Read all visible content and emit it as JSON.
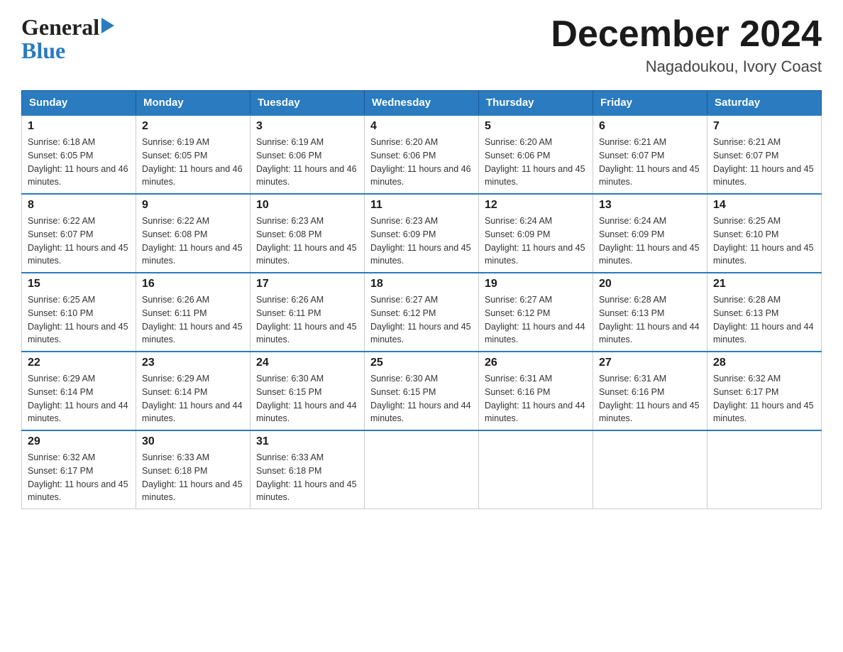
{
  "header": {
    "month_title": "December 2024",
    "location": "Nagadoukou, Ivory Coast"
  },
  "logo": {
    "line1": "General",
    "line2": "Blue"
  },
  "columns": [
    "Sunday",
    "Monday",
    "Tuesday",
    "Wednesday",
    "Thursday",
    "Friday",
    "Saturday"
  ],
  "weeks": [
    [
      {
        "day": "1",
        "sunrise": "6:18 AM",
        "sunset": "6:05 PM",
        "daylight": "11 hours and 46 minutes."
      },
      {
        "day": "2",
        "sunrise": "6:19 AM",
        "sunset": "6:05 PM",
        "daylight": "11 hours and 46 minutes."
      },
      {
        "day": "3",
        "sunrise": "6:19 AM",
        "sunset": "6:06 PM",
        "daylight": "11 hours and 46 minutes."
      },
      {
        "day": "4",
        "sunrise": "6:20 AM",
        "sunset": "6:06 PM",
        "daylight": "11 hours and 46 minutes."
      },
      {
        "day": "5",
        "sunrise": "6:20 AM",
        "sunset": "6:06 PM",
        "daylight": "11 hours and 45 minutes."
      },
      {
        "day": "6",
        "sunrise": "6:21 AM",
        "sunset": "6:07 PM",
        "daylight": "11 hours and 45 minutes."
      },
      {
        "day": "7",
        "sunrise": "6:21 AM",
        "sunset": "6:07 PM",
        "daylight": "11 hours and 45 minutes."
      }
    ],
    [
      {
        "day": "8",
        "sunrise": "6:22 AM",
        "sunset": "6:07 PM",
        "daylight": "11 hours and 45 minutes."
      },
      {
        "day": "9",
        "sunrise": "6:22 AM",
        "sunset": "6:08 PM",
        "daylight": "11 hours and 45 minutes."
      },
      {
        "day": "10",
        "sunrise": "6:23 AM",
        "sunset": "6:08 PM",
        "daylight": "11 hours and 45 minutes."
      },
      {
        "day": "11",
        "sunrise": "6:23 AM",
        "sunset": "6:09 PM",
        "daylight": "11 hours and 45 minutes."
      },
      {
        "day": "12",
        "sunrise": "6:24 AM",
        "sunset": "6:09 PM",
        "daylight": "11 hours and 45 minutes."
      },
      {
        "day": "13",
        "sunrise": "6:24 AM",
        "sunset": "6:09 PM",
        "daylight": "11 hours and 45 minutes."
      },
      {
        "day": "14",
        "sunrise": "6:25 AM",
        "sunset": "6:10 PM",
        "daylight": "11 hours and 45 minutes."
      }
    ],
    [
      {
        "day": "15",
        "sunrise": "6:25 AM",
        "sunset": "6:10 PM",
        "daylight": "11 hours and 45 minutes."
      },
      {
        "day": "16",
        "sunrise": "6:26 AM",
        "sunset": "6:11 PM",
        "daylight": "11 hours and 45 minutes."
      },
      {
        "day": "17",
        "sunrise": "6:26 AM",
        "sunset": "6:11 PM",
        "daylight": "11 hours and 45 minutes."
      },
      {
        "day": "18",
        "sunrise": "6:27 AM",
        "sunset": "6:12 PM",
        "daylight": "11 hours and 45 minutes."
      },
      {
        "day": "19",
        "sunrise": "6:27 AM",
        "sunset": "6:12 PM",
        "daylight": "11 hours and 44 minutes."
      },
      {
        "day": "20",
        "sunrise": "6:28 AM",
        "sunset": "6:13 PM",
        "daylight": "11 hours and 44 minutes."
      },
      {
        "day": "21",
        "sunrise": "6:28 AM",
        "sunset": "6:13 PM",
        "daylight": "11 hours and 44 minutes."
      }
    ],
    [
      {
        "day": "22",
        "sunrise": "6:29 AM",
        "sunset": "6:14 PM",
        "daylight": "11 hours and 44 minutes."
      },
      {
        "day": "23",
        "sunrise": "6:29 AM",
        "sunset": "6:14 PM",
        "daylight": "11 hours and 44 minutes."
      },
      {
        "day": "24",
        "sunrise": "6:30 AM",
        "sunset": "6:15 PM",
        "daylight": "11 hours and 44 minutes."
      },
      {
        "day": "25",
        "sunrise": "6:30 AM",
        "sunset": "6:15 PM",
        "daylight": "11 hours and 44 minutes."
      },
      {
        "day": "26",
        "sunrise": "6:31 AM",
        "sunset": "6:16 PM",
        "daylight": "11 hours and 44 minutes."
      },
      {
        "day": "27",
        "sunrise": "6:31 AM",
        "sunset": "6:16 PM",
        "daylight": "11 hours and 45 minutes."
      },
      {
        "day": "28",
        "sunrise": "6:32 AM",
        "sunset": "6:17 PM",
        "daylight": "11 hours and 45 minutes."
      }
    ],
    [
      {
        "day": "29",
        "sunrise": "6:32 AM",
        "sunset": "6:17 PM",
        "daylight": "11 hours and 45 minutes."
      },
      {
        "day": "30",
        "sunrise": "6:33 AM",
        "sunset": "6:18 PM",
        "daylight": "11 hours and 45 minutes."
      },
      {
        "day": "31",
        "sunrise": "6:33 AM",
        "sunset": "6:18 PM",
        "daylight": "11 hours and 45 minutes."
      },
      null,
      null,
      null,
      null
    ]
  ],
  "labels": {
    "sunrise": "Sunrise:",
    "sunset": "Sunset:",
    "daylight": "Daylight:"
  }
}
